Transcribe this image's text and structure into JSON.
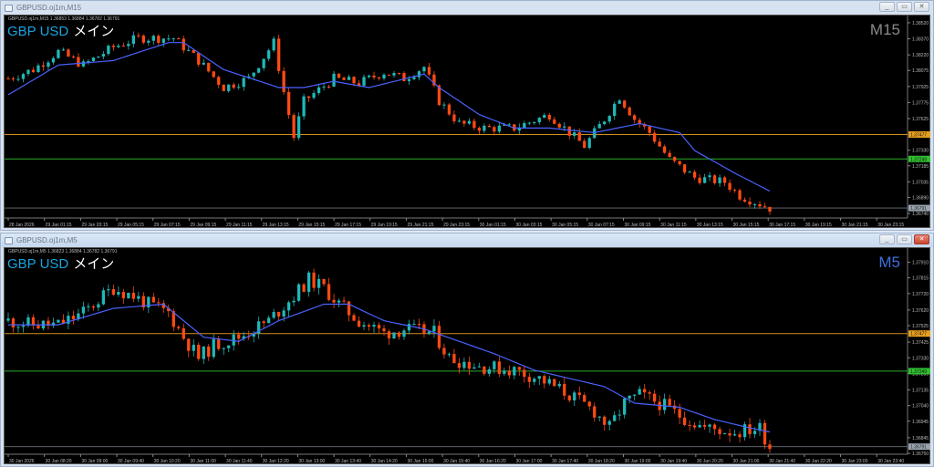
{
  "windows": [
    {
      "title": "GBPUSD.oj1m,M15",
      "header": "GBPUSD.oj1m,M15  1.36853 1.36884 1.36782 1.36791",
      "symbol": "GBP USD",
      "label": "メイン",
      "timeframe": "M15",
      "timeframe_color": "#8a8a8a",
      "active": false,
      "buttons": {
        "minimize": "_",
        "restore": "▭",
        "close": "✕"
      },
      "price_labels": [
        "1.38520",
        "1.38370",
        "1.38220",
        "1.38075",
        "1.37925",
        "1.37775",
        "1.37625",
        "1.37330",
        "1.37185",
        "1.37035",
        "1.36890",
        "1.36740"
      ],
      "time_labels": [
        "28 Jan 2026",
        "29 Jan 01:15",
        "29 Jan 03:15",
        "29 Jan 05:15",
        "29 Jan 07:15",
        "29 Jan 09:15",
        "29 Jan 11:15",
        "29 Jan 13:15",
        "29 Jan 15:15",
        "29 Jan 17:15",
        "29 Jan 19:15",
        "29 Jan 21:15",
        "29 Jan 23:15",
        "30 Jan 01:15",
        "30 Jan 03:15",
        "30 Jan 05:15",
        "30 Jan 07:15",
        "30 Jan 09:15",
        "30 Jan 11:15",
        "30 Jan 13:15",
        "30 Jan 15:15",
        "30 Jan 17:15",
        "30 Jan 19:15",
        "30 Jan 21:15",
        "30 Jan 23:15"
      ],
      "levels": [
        {
          "price": 1.37477,
          "label": "1.37477",
          "color": "#e8a020"
        },
        {
          "price": 1.37249,
          "label": "1.37249",
          "color": "#30c030"
        },
        {
          "price": 1.36791,
          "label": "1.36791",
          "color": "#9aa4b0"
        }
      ],
      "chart_data": {
        "type": "candlestick",
        "bars": 152,
        "close_path": [
          [
            0,
            1.38
          ],
          [
            5,
            1.38083
          ],
          [
            10,
            1.38251
          ],
          [
            15,
            1.38125
          ],
          [
            21,
            1.38293
          ],
          [
            26,
            1.38377
          ],
          [
            33,
            1.38377
          ],
          [
            35,
            1.38293
          ],
          [
            38,
            1.38167
          ],
          [
            43,
            1.37915
          ],
          [
            48,
            1.38
          ],
          [
            53,
            1.38335
          ],
          [
            55,
            1.37873
          ],
          [
            57,
            1.37453
          ],
          [
            59,
            1.37789
          ],
          [
            65,
            1.38
          ],
          [
            70,
            1.37957
          ],
          [
            75,
            1.38058
          ],
          [
            79,
            1.38
          ],
          [
            83,
            1.38108
          ],
          [
            86,
            1.37789
          ],
          [
            90,
            1.37579
          ],
          [
            95,
            1.37537
          ],
          [
            101,
            1.37537
          ],
          [
            108,
            1.37663
          ],
          [
            112,
            1.37495
          ],
          [
            115,
            1.37369
          ],
          [
            119,
            1.37621
          ],
          [
            122,
            1.37831
          ],
          [
            125,
            1.37621
          ],
          [
            128,
            1.37495
          ],
          [
            132,
            1.37243
          ],
          [
            137,
            1.37075
          ],
          [
            143,
            1.37033
          ],
          [
            146,
            1.36907
          ],
          [
            152,
            1.36791
          ]
        ],
        "ma_path": [
          [
            0,
            1.37848
          ],
          [
            10,
            1.38125
          ],
          [
            21,
            1.38167
          ],
          [
            32,
            1.38335
          ],
          [
            35,
            1.38335
          ],
          [
            43,
            1.38083
          ],
          [
            54,
            1.37915
          ],
          [
            59,
            1.37915
          ],
          [
            65,
            1.37974
          ],
          [
            72,
            1.37915
          ],
          [
            83,
            1.38041
          ],
          [
            86,
            1.37915
          ],
          [
            94,
            1.37663
          ],
          [
            101,
            1.37537
          ],
          [
            108,
            1.37537
          ],
          [
            117,
            1.37495
          ],
          [
            126,
            1.37579
          ],
          [
            134,
            1.37495
          ],
          [
            137,
            1.37327
          ],
          [
            145,
            1.37117
          ],
          [
            152,
            1.36949
          ]
        ],
        "ylim": [
          1.36698,
          1.38579
        ]
      }
    },
    {
      "title": "GBPUSD.oj1m,M5",
      "header": "GBPUSD.oj1m,M5  1.36823 1.36884 1.36782 1.36791",
      "symbol": "GBP USD",
      "label": "メイン",
      "timeframe": "M5",
      "timeframe_color": "#3d6fe0",
      "active": true,
      "buttons": {
        "minimize": "_",
        "restore": "▭",
        "close": "✕"
      },
      "price_labels": [
        "1.37910",
        "1.37815",
        "1.37720",
        "1.37620",
        "1.37525",
        "1.37425",
        "1.37330",
        "1.37235",
        "1.37135",
        "1.37040",
        "1.36945",
        "1.36845",
        "1.36750"
      ],
      "time_labels": [
        "30 Jan 2026",
        "30 Jan 08:20",
        "30 Jan 09:00",
        "30 Jan 09:40",
        "30 Jan 10:20",
        "30 Jan 11:00",
        "30 Jan 11:40",
        "30 Jan 12:20",
        "30 Jan 13:00",
        "30 Jan 13:40",
        "30 Jan 14:20",
        "30 Jan 15:00",
        "30 Jan 15:40",
        "30 Jan 16:20",
        "30 Jan 17:00",
        "30 Jan 17:40",
        "30 Jan 18:20",
        "30 Jan 19:00",
        "30 Jan 19:40",
        "30 Jan 20:20",
        "30 Jan 21:00",
        "30 Jan 21:40",
        "30 Jan 22:20",
        "30 Jan 23:00",
        "30 Jan 23:40"
      ],
      "levels": [
        {
          "price": 1.37477,
          "label": "1.37477",
          "color": "#e8a020"
        },
        {
          "price": 1.37249,
          "label": "1.37249",
          "color": "#30c030"
        },
        {
          "price": 1.36791,
          "label": "1.36791",
          "color": "#9aa4b0"
        }
      ],
      "chart_data": {
        "type": "candlestick",
        "bars": 152,
        "close_path": [
          [
            0,
            1.37555
          ],
          [
            5,
            1.3753
          ],
          [
            10,
            1.3753
          ],
          [
            15,
            1.37605
          ],
          [
            21,
            1.37755
          ],
          [
            25,
            1.37705
          ],
          [
            28,
            1.37655
          ],
          [
            32,
            1.37605
          ],
          [
            35,
            1.37455
          ],
          [
            38,
            1.3733
          ],
          [
            41,
            1.37405
          ],
          [
            46,
            1.37455
          ],
          [
            52,
            1.37555
          ],
          [
            57,
            1.37705
          ],
          [
            60,
            1.37805
          ],
          [
            63,
            1.37755
          ],
          [
            66,
            1.37655
          ],
          [
            70,
            1.37555
          ],
          [
            75,
            1.3748
          ],
          [
            79,
            1.37505
          ],
          [
            85,
            1.3748
          ],
          [
            88,
            1.3733
          ],
          [
            94,
            1.3728
          ],
          [
            101,
            1.37255
          ],
          [
            106,
            1.37205
          ],
          [
            112,
            1.37105
          ],
          [
            117,
            1.37005
          ],
          [
            120,
            1.36905
          ],
          [
            123,
            1.37055
          ],
          [
            126,
            1.37105
          ],
          [
            130,
            1.37055
          ],
          [
            134,
            1.3698
          ],
          [
            139,
            1.36905
          ],
          [
            145,
            1.3688
          ],
          [
            150,
            1.36905
          ],
          [
            152,
            1.36791
          ]
        ],
        "ma_path": [
          [
            0,
            1.3753
          ],
          [
            10,
            1.3753
          ],
          [
            21,
            1.3763
          ],
          [
            31,
            1.37655
          ],
          [
            39,
            1.37455
          ],
          [
            46,
            1.3743
          ],
          [
            54,
            1.37555
          ],
          [
            63,
            1.37655
          ],
          [
            68,
            1.37655
          ],
          [
            75,
            1.37555
          ],
          [
            83,
            1.37505
          ],
          [
            90,
            1.3743
          ],
          [
            97,
            1.37355
          ],
          [
            105,
            1.37255
          ],
          [
            112,
            1.37205
          ],
          [
            119,
            1.37155
          ],
          [
            125,
            1.37055
          ],
          [
            134,
            1.3703
          ],
          [
            141,
            1.36955
          ],
          [
            148,
            1.36905
          ],
          [
            152,
            1.3688
          ]
        ],
        "ylim": [
          1.36745,
          1.3799
        ]
      }
    }
  ]
}
